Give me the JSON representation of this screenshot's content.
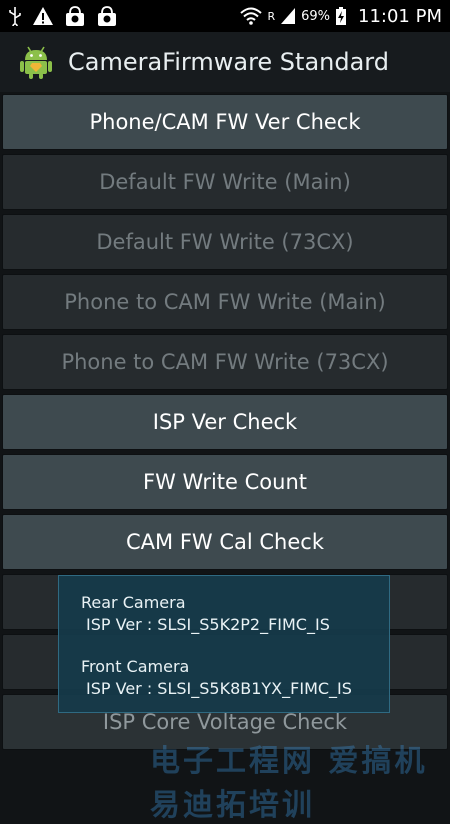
{
  "status_bar": {
    "icons": [
      "usb-icon",
      "warning-icon",
      "shopping-bag-icon",
      "shopping-bag-icon",
      "wifi-icon",
      "roaming-signal-icon",
      "battery-charging-icon"
    ],
    "roaming": "R",
    "battery_percent": "69%",
    "time": "11:01 PM"
  },
  "action_bar": {
    "icon": "android-icon",
    "title": "CameraFirmware Standard"
  },
  "buttons": [
    {
      "label": "Phone/CAM FW Ver Check",
      "state": "enabled"
    },
    {
      "label": "Default FW Write (Main)",
      "state": "disabled"
    },
    {
      "label": "Default FW Write (73CX)",
      "state": "disabled"
    },
    {
      "label": "Phone to CAM FW Write (Main)",
      "state": "disabled"
    },
    {
      "label": "Phone to CAM FW Write (73CX)",
      "state": "disabled"
    },
    {
      "label": "ISP Ver Check",
      "state": "enabled"
    },
    {
      "label": "FW Write Count",
      "state": "enabled"
    },
    {
      "label": "CAM FW Cal Check",
      "state": "enabled"
    },
    {
      "label": "",
      "state": "disabled"
    },
    {
      "label": "",
      "state": "disabled"
    },
    {
      "label": "ISP Core Voltage Check",
      "state": "enabled"
    }
  ],
  "popup": {
    "rear_title": "Rear Camera",
    "rear_isp": "ISP Ver : SLSI_S5K2P2_FIMC_IS",
    "front_title": "Front Camera",
    "front_isp": "ISP Ver : SLSI_S5K8B1YX_FIMC_IS"
  },
  "watermark": {
    "text": "电子工程网 爱搞机 易迪拓培训"
  }
}
